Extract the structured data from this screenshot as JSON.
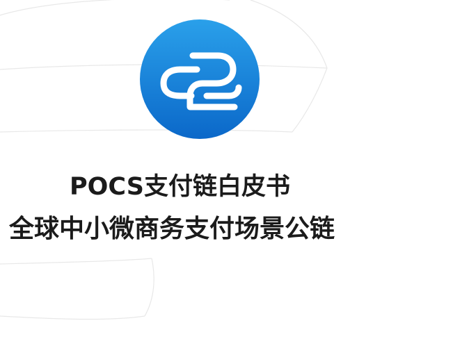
{
  "logo": {
    "icon": "pocs-chain-logo-icon",
    "gradient_top": "#2aa0ea",
    "gradient_bottom": "#0b68c9",
    "glyph_color": "#ffffff"
  },
  "title": "POCS支付链白皮书",
  "subtitle": "全球中小微商务支付场景公链",
  "colors": {
    "text": "#1b1b1b",
    "background": "#ffffff",
    "decor_line": "#e6e6e6"
  }
}
